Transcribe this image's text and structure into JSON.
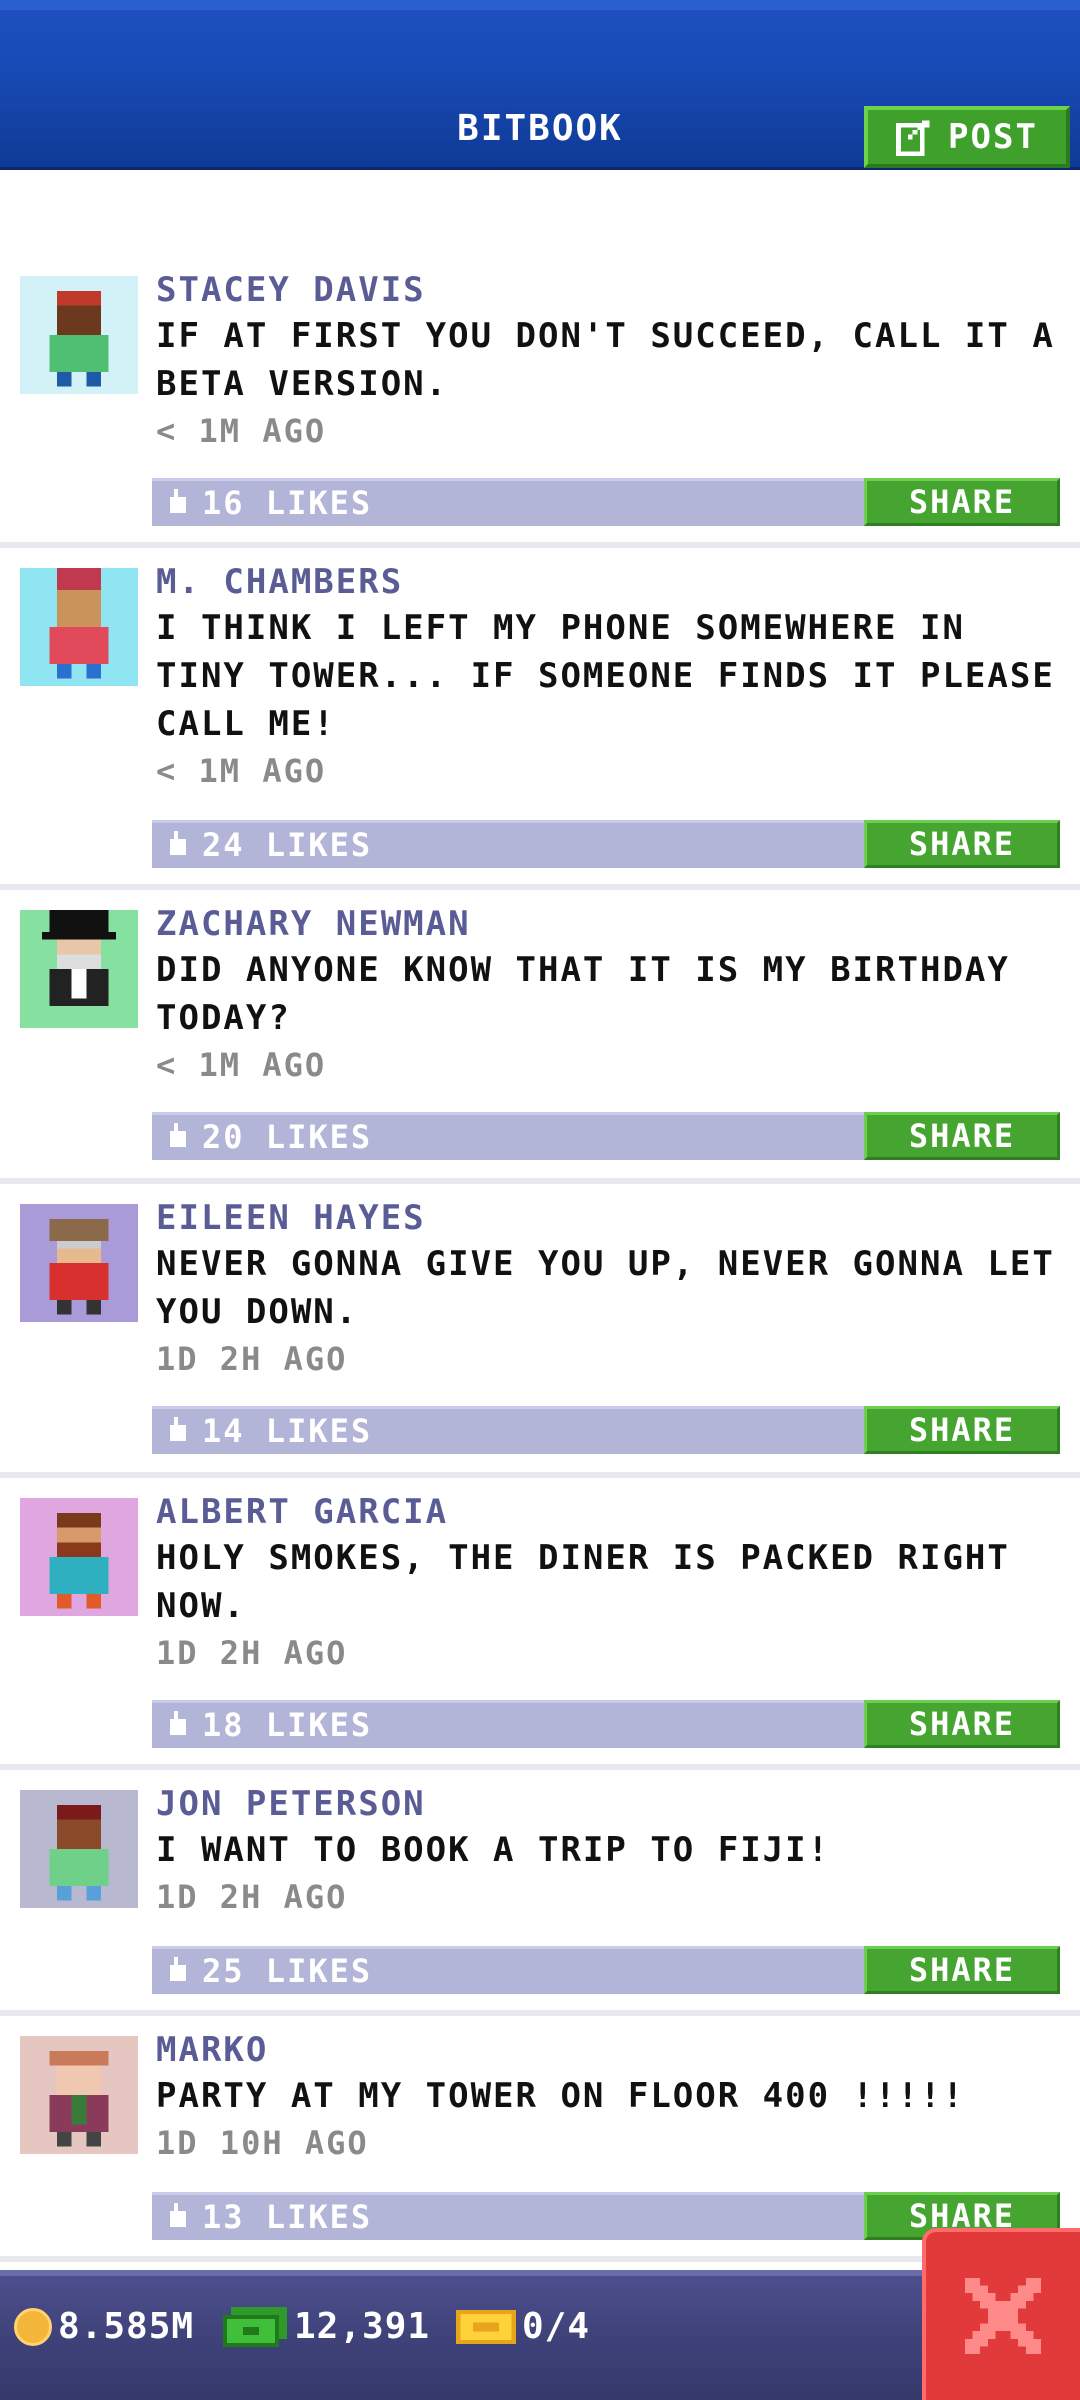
{
  "header": {
    "title": "BITBOOK",
    "post_label": "POST",
    "post_icon": "edit-icon"
  },
  "posts": [
    {
      "author": "STACEY DAVIS",
      "message": "IF AT FIRST YOU DON'T SUCCEED, CALL IT A BETA VERSION.",
      "time": "< 1M AGO",
      "likes": "16 LIKES",
      "share": "SHARE",
      "avatar_bg": "#d3f2f7"
    },
    {
      "author": "M. CHAMBERS",
      "message": "I THINK I LEFT MY PHONE SOMEWHERE IN TINY TOWER... IF SOMEONE FINDS IT PLEASE CALL ME!",
      "time": "< 1M AGO",
      "likes": "24 LIKES",
      "share": "SHARE",
      "avatar_bg": "#8fe6f2"
    },
    {
      "author": "ZACHARY NEWMAN",
      "message": "DID ANYONE KNOW THAT IT IS MY BIRTHDAY TODAY?",
      "time": "< 1M AGO",
      "likes": "20 LIKES",
      "share": "SHARE",
      "avatar_bg": "#86e0a0"
    },
    {
      "author": "EILEEN HAYES",
      "message": "NEVER GONNA GIVE YOU UP, NEVER GONNA LET YOU DOWN.",
      "time": "1D 2H AGO",
      "likes": "14 LIKES",
      "share": "SHARE",
      "avatar_bg": "#a99ad8"
    },
    {
      "author": "ALBERT GARCIA",
      "message": "HOLY SMOKES, THE DINER IS PACKED RIGHT NOW.",
      "time": "1D 2H AGO",
      "likes": "18 LIKES",
      "share": "SHARE",
      "avatar_bg": "#e0a6e0"
    },
    {
      "author": "JON PETERSON",
      "message": "I WANT TO BOOK A TRIP TO FIJI!",
      "time": "1D 2H AGO",
      "likes": "25 LIKES",
      "share": "SHARE",
      "avatar_bg": "#b8b8d0"
    },
    {
      "author": "MARKO",
      "message": "PARTY AT MY TOWER ON FLOOR 400 !!!!!",
      "time": "1D 10H AGO",
      "likes": "13 LIKES",
      "share": "SHARE",
      "avatar_bg": "#e6c6c0"
    }
  ],
  "footer": {
    "coins": "8.585M",
    "bux": "12,391",
    "tickets": "0/4",
    "close_icon": "close-icon"
  },
  "colors": {
    "header_blue": "#184ab5",
    "button_green": "#45a530",
    "like_bar": "#b3b5d8",
    "author_text": "#5a5c96",
    "close_red": "#e23a3a"
  }
}
